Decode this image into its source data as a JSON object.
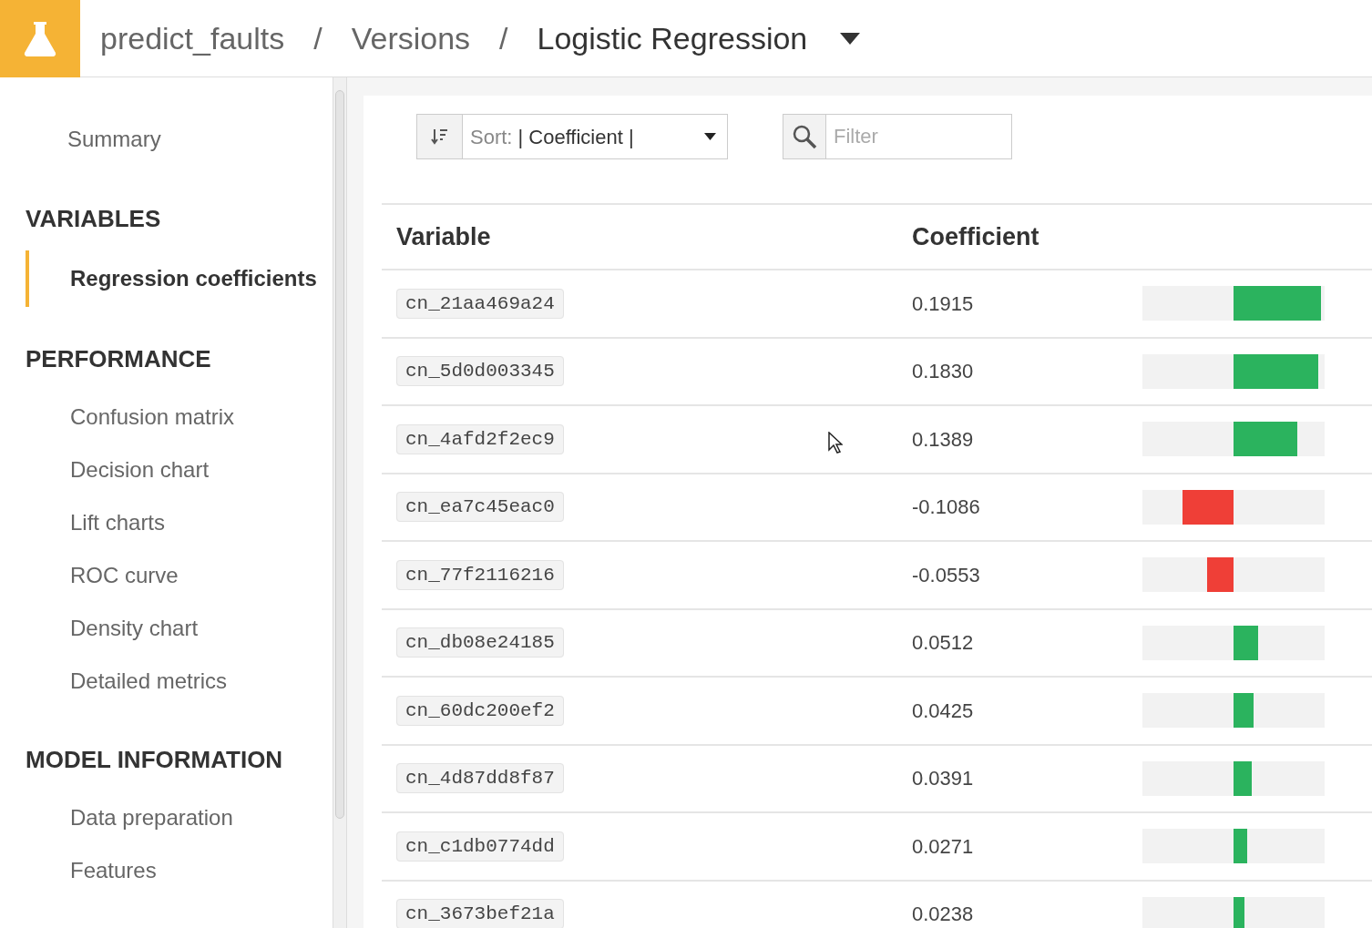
{
  "breadcrumb": [
    {
      "label": "predict_faults",
      "current": false
    },
    {
      "label": "Versions",
      "current": false,
      "separator": "/"
    },
    {
      "label": "Logistic Regression",
      "current": true,
      "separator": "/"
    }
  ],
  "sidebar": {
    "items": [
      {
        "label": "Summary",
        "selected": false
      }
    ],
    "sections": [
      {
        "title": "VARIABLES",
        "items": [
          {
            "label": "Regression coefficients",
            "selected": true
          }
        ]
      },
      {
        "title": "PERFORMANCE",
        "items": [
          {
            "label": "Confusion matrix",
            "selected": false
          },
          {
            "label": "Decision chart",
            "selected": false
          },
          {
            "label": "Lift charts",
            "selected": false
          },
          {
            "label": "ROC curve",
            "selected": false
          },
          {
            "label": "Density chart",
            "selected": false
          },
          {
            "label": "Detailed metrics",
            "selected": false
          }
        ]
      },
      {
        "title": "MODEL INFORMATION",
        "items": [
          {
            "label": "Data preparation",
            "selected": false
          },
          {
            "label": "Features",
            "selected": false
          }
        ]
      }
    ]
  },
  "toolbar": {
    "sort_label": "Sort:",
    "sort_value": "| Coefficient |",
    "filter": {
      "placeholder": "Filter"
    }
  },
  "table": {
    "columns": [
      "Variable",
      "Coefficient"
    ],
    "rows": [
      {
        "variable": "cn_21aa469a24",
        "coefficient": "0.1915",
        "kind": "positive",
        "level": 0.96
      },
      {
        "variable": "cn_5d0d003345",
        "coefficient": "0.1830",
        "kind": "positive",
        "level": 0.93
      },
      {
        "variable": "cn_4afd2f2ec9",
        "coefficient": "0.1389",
        "kind": "positive",
        "level": 0.7
      },
      {
        "variable": "cn_ea7c45eac0",
        "coefficient": "-0.1086",
        "kind": "negative",
        "level": 0.56
      },
      {
        "variable": "cn_77f2116216",
        "coefficient": "-0.0553",
        "kind": "negative",
        "level": 0.29
      },
      {
        "variable": "cn_db08e24185",
        "coefficient": "0.0512",
        "kind": "positive",
        "level": 0.27
      },
      {
        "variable": "cn_60dc200ef2",
        "coefficient": "0.0425",
        "kind": "positive",
        "level": 0.22
      },
      {
        "variable": "cn_4d87dd8f87",
        "coefficient": "0.0391",
        "kind": "positive",
        "level": 0.2
      },
      {
        "variable": "cn_c1db0774dd",
        "coefficient": "0.0271",
        "kind": "positive",
        "level": 0.15
      },
      {
        "variable": "cn_3673bef21a",
        "coefficient": "0.0238",
        "kind": "positive",
        "level": 0.12
      }
    ]
  }
}
